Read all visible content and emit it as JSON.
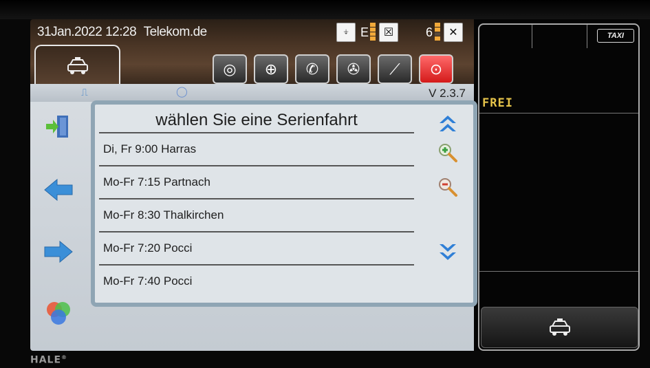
{
  "header": {
    "datetime": "31Jan.2022 12:28",
    "network": "Telekom.de",
    "indicator_e": "E",
    "indicator_6": "6"
  },
  "icons": {
    "home_tab": "taxi-car-icon",
    "toolbar": [
      "timer-icon",
      "network-icon",
      "phone-icon",
      "satellite-icon",
      "tools-icon",
      "lock-icon"
    ]
  },
  "main": {
    "version": "V 2.3.7",
    "list_title": "wählen Sie eine Serienfahrt",
    "items": [
      "Di, Fr 9:00 Harras",
      "Mo-Fr 7:15 Partnach",
      "Mo-Fr 8:30 Thalkirchen",
      "Mo-Fr 7:20 Pocci",
      "Mo-Fr 7:40 Pocci"
    ]
  },
  "right": {
    "badge": "TAXI",
    "status": "FREI"
  },
  "brand": "HALE",
  "colors": {
    "accent_blue": "#3b8fd8",
    "status_yellow": "#e6c44a",
    "frame": "#8fa5b4"
  }
}
